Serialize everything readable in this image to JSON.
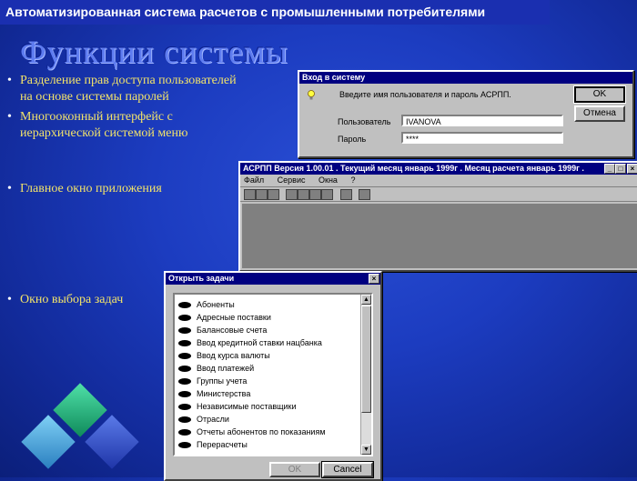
{
  "header": {
    "title": "Автоматизированная система расчетов с промышленными потребителями"
  },
  "slide": {
    "title": "Функции системы",
    "bullets": [
      {
        "line1": "Разделение прав доступа пользователей",
        "line2": "на основе системы паролей"
      },
      {
        "line1": "Многооконный интерфейс с",
        "line2": "иерархической системой меню"
      },
      {
        "line1": "Главное окно приложения",
        "line2": ""
      },
      {
        "line1": "Окно выбора задач",
        "line2": ""
      }
    ]
  },
  "login": {
    "title": "Вход в систему",
    "prompt": "Введите имя пользователя и пароль АСРПП.",
    "user_label": "Пользователь",
    "user_value": "IVANOVA",
    "password_label": "Пароль",
    "password_value": "****",
    "ok_label": "OK",
    "cancel_label": "Отмена"
  },
  "main_window": {
    "title": "АСРПП Версия 1.00.01 . Текущий месяц январь 1999г . Месяц расчета январь 1999г .",
    "menu": [
      "Файл",
      "Сервис",
      "Окна",
      "?"
    ]
  },
  "tasks_dialog": {
    "title": "Открыть задачи",
    "items": [
      "Абоненты",
      "Адресные поставки",
      "Балансовые счета",
      "Ввод кредитной ставки нацбанка",
      "Ввод курса валюты",
      "Ввод платежей",
      "Группы учета",
      "Министерства",
      "Независимые  поставщики",
      "Отрасли",
      "Отчеты абонентов по показаниям",
      "Перерасчеты"
    ],
    "ok_label": "OK",
    "cancel_label": "Cancel"
  },
  "colors": {
    "background": "#1c3cc0",
    "bullet_text": "#f2e36a",
    "window_titlebar": "#000080",
    "window_face": "#c0c0c0"
  },
  "icons": [
    "lightbulb-icon",
    "close-icon",
    "minimize-icon",
    "maximize-icon",
    "item-oval-icon"
  ]
}
